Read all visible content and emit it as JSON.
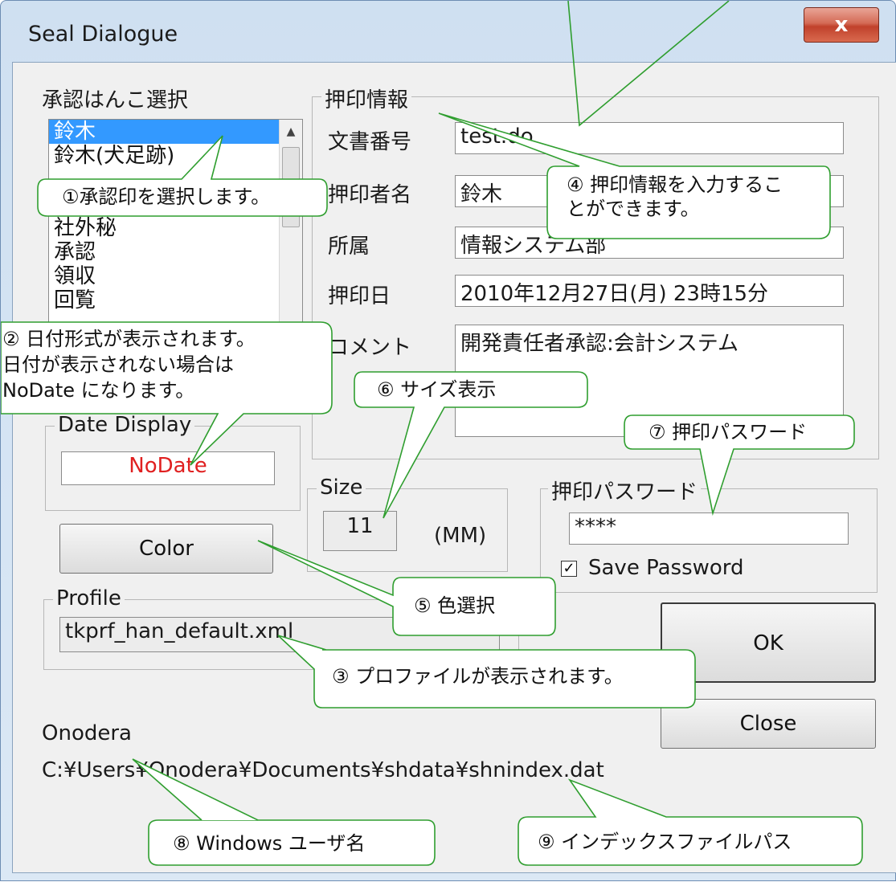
{
  "window": {
    "title": "Seal Dialogue",
    "close_glyph": "x"
  },
  "seal_select": {
    "label": "承認はんこ選択",
    "items": [
      "鈴木",
      "鈴木(犬足跡)",
      "",
      "",
      "社外秘",
      "承認",
      "領収",
      "回覧"
    ],
    "selected": "鈴木"
  },
  "stamp_info": {
    "group_title": "押印情報",
    "doc_number_label": "文書番号",
    "doc_number_value": "test.do",
    "name_label": "押印者名",
    "name_value": "鈴木",
    "dept_label": "所属",
    "dept_value": "情報システム部",
    "date_label": "押印日",
    "date_value": "2010年12月27日(月) 23時15分",
    "comment_label": "コメント",
    "comment_value": "開発責任者承認:会計システム"
  },
  "date_display": {
    "group_title": "Date Display",
    "value": "NoDate",
    "value_color": "#e02020"
  },
  "size": {
    "group_title": "Size",
    "value": "11",
    "unit": "(MM)"
  },
  "password": {
    "group_title": "押印パスワード",
    "value": "****",
    "save_label": "Save Password",
    "save_checked": true
  },
  "buttons": {
    "color": "Color",
    "ok": "OK",
    "close": "Close"
  },
  "profile": {
    "group_title": "Profile",
    "value": "tkprf_han_default.xml"
  },
  "footer": {
    "user_name": "Onodera",
    "index_path": "C:¥Users¥Onodera¥Documents¥shdata¥shnindex.dat"
  },
  "callouts": {
    "c1": "①承認印を選択します。",
    "c2_line1": "② 日付形式が表示されます。",
    "c2_line2": "日付が表示されない場合は",
    "c2_line3": "NoDate になります。",
    "c3": "③ プロファイルが表示されます。",
    "c4_line1": "④ 押印情報を入力するこ",
    "c4_line2": "とができます。",
    "c5": "⑤ 色選択",
    "c6": "⑥ サイズ表示",
    "c7": "⑦ 押印パスワード",
    "c8": "⑧ Windows ユーザ名",
    "c9": "⑨ インデックスファイルパス",
    "fill_color": "#ffffff",
    "border_color": "#2f9e2f"
  }
}
